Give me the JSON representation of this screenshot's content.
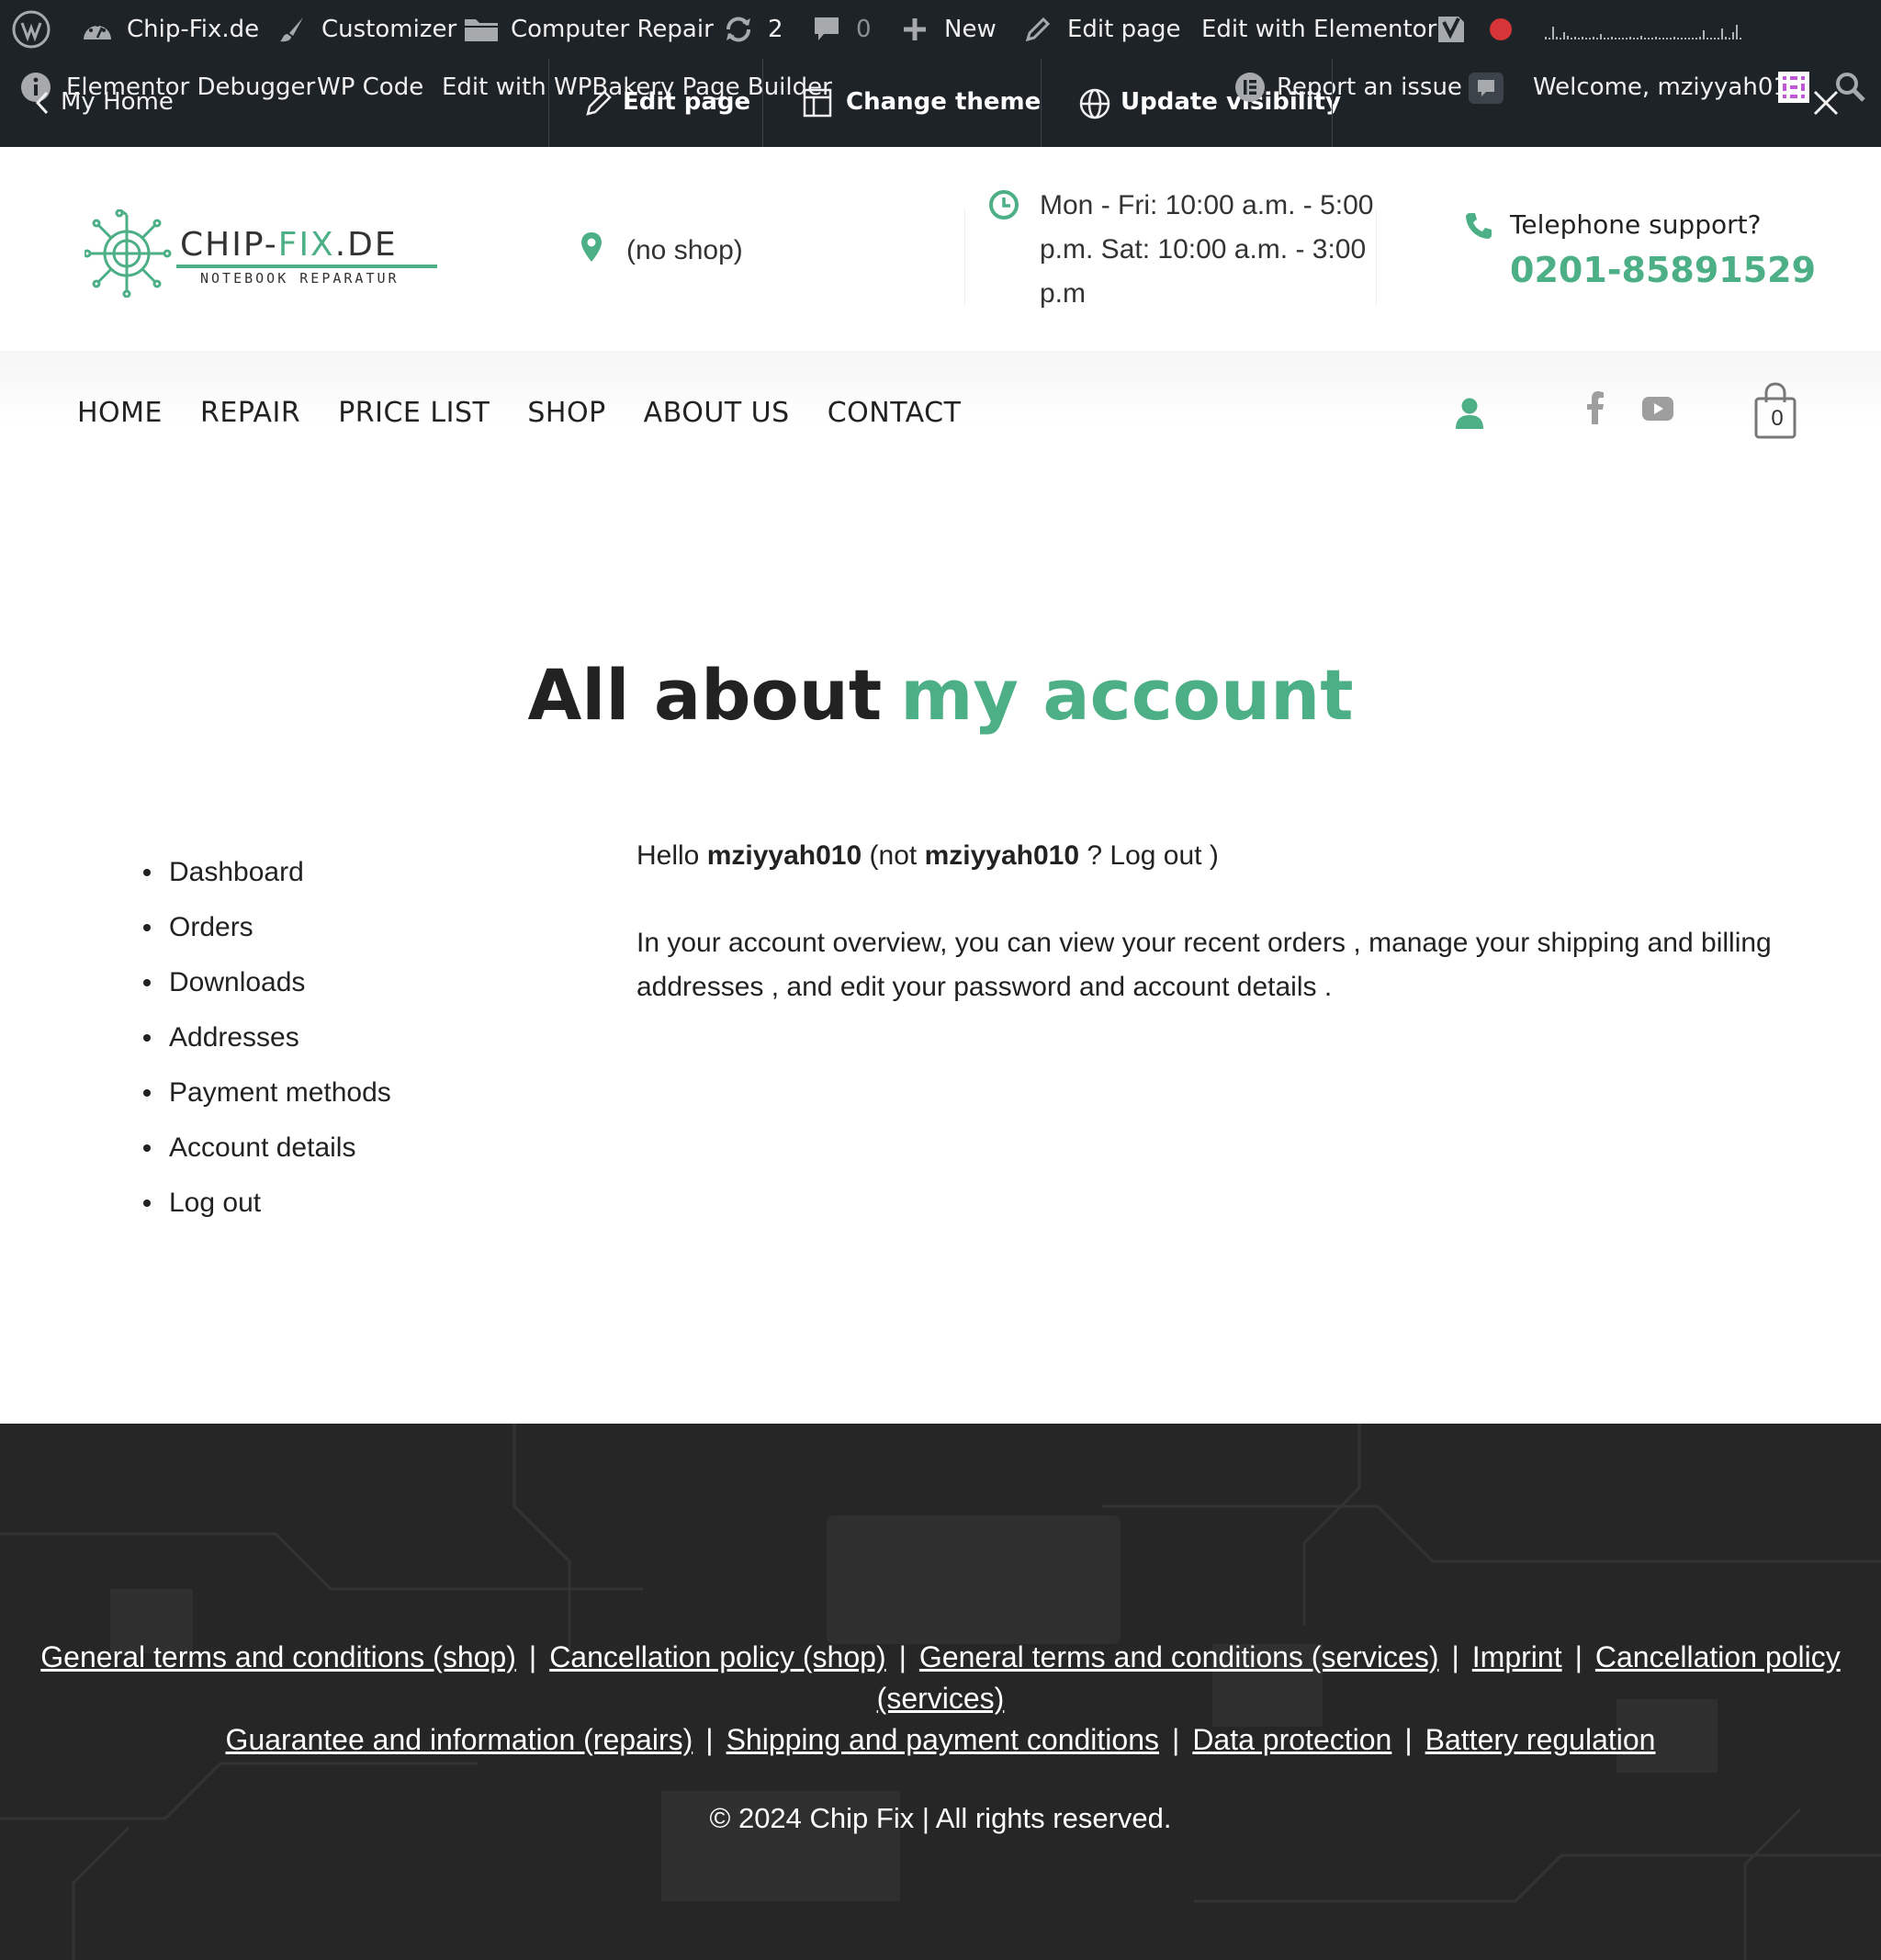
{
  "admin_bar": {
    "site_name": "Chip-Fix.de",
    "customizer": "Customizer",
    "computer_repair": "Computer Repair",
    "updates_count": "2",
    "comments_count": "0",
    "new_label": "New",
    "edit_page": "Edit page",
    "edit_elementor": "Edit with Elementor",
    "row2": {
      "elementor_debugger": "Elementor Debugger",
      "my_home": "My Home",
      "wp_code": "WP Code",
      "edit_wpbakery": "Edit with WPBakery Page Builder",
      "edit_page": "Edit page",
      "change_theme": "Change theme",
      "update_visibility": "Update visibility",
      "report_issue": "Report an issue",
      "welcome": "Welcome, mziyyah010"
    }
  },
  "header": {
    "logo_brand_a": "CHIP-",
    "logo_brand_b": "FIX",
    "logo_brand_c": ".DE",
    "logo_sub": "NOTEBOOK REPARATUR",
    "shop": "(no shop)",
    "hours": "Mon - Fri: 10:00 a.m. - 5:00 p.m. Sat: 10:00 a.m. - 3:00 p.m",
    "phone_label": "Telephone support?",
    "phone_number": "0201-85891529"
  },
  "nav": {
    "items": [
      "HOME",
      "REPAIR",
      "PRICE LIST",
      "SHOP",
      "ABOUT US",
      "CONTACT"
    ],
    "cart_count": "0"
  },
  "page": {
    "title_main": "All about",
    "title_accent": "my account"
  },
  "account_nav": [
    "Dashboard",
    "Orders",
    "Downloads",
    "Addresses",
    "Payment methods",
    "Account details",
    "Log out"
  ],
  "account_content": {
    "hello": "Hello",
    "username": "mziyyah010",
    "not": "(not",
    "username2": "mziyyah010",
    "question": "?",
    "logout": "Log out",
    "close_paren": ")",
    "overview_1": "In your account overview, you can view your",
    "recent_orders": "recent orders",
    "overview_2": ", manage your",
    "addresses": "shipping and billing addresses",
    "overview_3": ", and",
    "account_details": "edit your password and account details",
    "overview_4": "."
  },
  "footer": {
    "links": [
      "General terms and conditions (shop)",
      "Cancellation policy (shop)",
      "General terms and conditions (services)",
      "Imprint",
      "Cancellation policy (services)",
      "Guarantee and information (repairs)",
      "Shipping and payment conditions",
      "Data protection",
      "Battery regulation"
    ],
    "copyright": "© 2024 Chip Fix | All rights reserved."
  },
  "colors": {
    "accent": "#4caf86",
    "admin_bar": "#1d2327",
    "footer": "#262626"
  },
  "icons": [
    "wordpress-icon",
    "dashboard-icon",
    "brush-icon",
    "folder-icon",
    "updates-icon",
    "comment-icon",
    "plus-icon",
    "pencil-icon",
    "yoast-icon",
    "record-icon",
    "info-icon",
    "chevron-left-icon",
    "layout-icon",
    "globe-icon",
    "elementor-icon",
    "feedback-icon",
    "avatar-icon",
    "close-icon",
    "search-icon",
    "map-pin-icon",
    "clock-icon",
    "phone-icon",
    "user-icon",
    "facebook-icon",
    "youtube-icon",
    "shopping-bag-icon"
  ]
}
